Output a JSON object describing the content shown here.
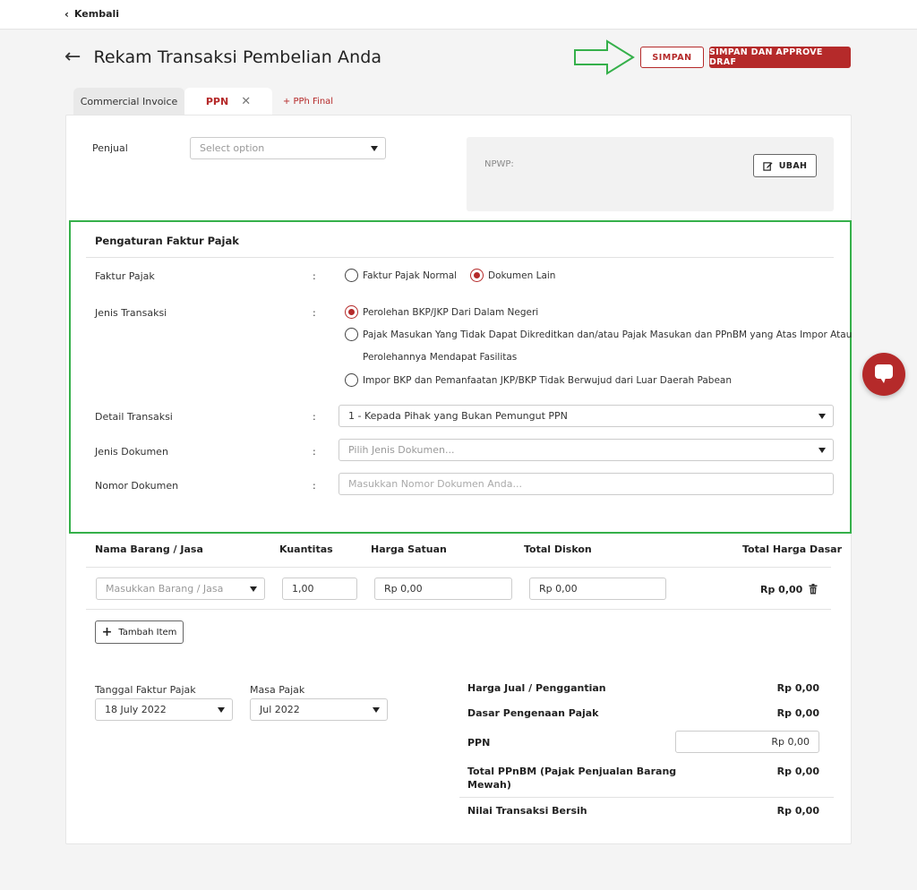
{
  "topbar": {
    "back_label": "Kembali"
  },
  "header": {
    "title": "Rekam Transaksi Pembelian Anda",
    "save_label": "SIMPAN",
    "approve_label": "SIMPAN DAN APPROVE DRAF"
  },
  "tabs": [
    {
      "label": "Commercial Invoice"
    },
    {
      "label": "PPN"
    },
    {
      "label": "+ PPh Final"
    }
  ],
  "seller": {
    "label": "Penjual",
    "placeholder": "Select option",
    "npwp_label": "NPWP:",
    "change_label": "UBAH"
  },
  "tax_settings": {
    "title": "Pengaturan Faktur Pajak",
    "colon": ":",
    "faktur_pajak": {
      "label": "Faktur Pajak",
      "options": [
        "Faktur Pajak Normal",
        "Dokumen Lain"
      ],
      "selected": "Dokumen Lain"
    },
    "jenis_transaksi": {
      "label": "Jenis Transaksi",
      "options": [
        "Perolehan BKP/JKP Dari Dalam Negeri",
        "Pajak Masukan Yang Tidak Dapat Dikreditkan dan/atau Pajak Masukan dan PPnBM yang Atas Impor Atau",
        "Perolehannya Mendapat Fasilitas",
        "Impor BKP dan Pemanfaatan JKP/BKP Tidak Berwujud dari Luar Daerah Pabean"
      ],
      "selected": "Perolehan BKP/JKP Dari Dalam Negeri"
    },
    "detail_transaksi": {
      "label": "Detail Transaksi",
      "value": "1 - Kepada Pihak yang Bukan Pemungut PPN"
    },
    "jenis_dokumen": {
      "label": "Jenis Dokumen",
      "placeholder": "Pilih Jenis Dokumen..."
    },
    "nomor_dokumen": {
      "label": "Nomor Dokumen",
      "placeholder": "Masukkan Nomor Dokumen Anda..."
    }
  },
  "items_table": {
    "headers": [
      "Nama Barang / Jasa",
      "Kuantitas",
      "Harga Satuan",
      "Total Diskon",
      "Total Harga Dasar"
    ],
    "row": {
      "item_placeholder": "Masukkan Barang / Jasa",
      "quantity": "1,00",
      "unit_price": "Rp 0,00",
      "discount": "Rp 0,00",
      "total": "Rp 0,00"
    },
    "add_item_label": "Tambah Item"
  },
  "dates": {
    "tanggal_label": "Tanggal Faktur Pajak",
    "tanggal_value": "18 July 2022",
    "masa_label": "Masa Pajak",
    "masa_value": "Jul 2022"
  },
  "summary": {
    "harga_jual_label": "Harga Jual / Penggantian",
    "harga_jual_value": "Rp 0,00",
    "dpp_label": "Dasar Pengenaan Pajak",
    "dpp_value": "Rp 0,00",
    "ppn_label": "PPN",
    "ppn_value": "Rp 0,00",
    "ppnbm_label_line1": "Total PPnBM (Pajak Penjualan Barang",
    "ppnbm_label_line2": "Mewah)",
    "ppnbm_value": "Rp 0,00",
    "net_label": "Nilai Transaksi Bersih",
    "net_value": "Rp 0,00"
  },
  "colors": {
    "brand_red": "#b52a2a",
    "highlight_green": "#35b04a"
  }
}
